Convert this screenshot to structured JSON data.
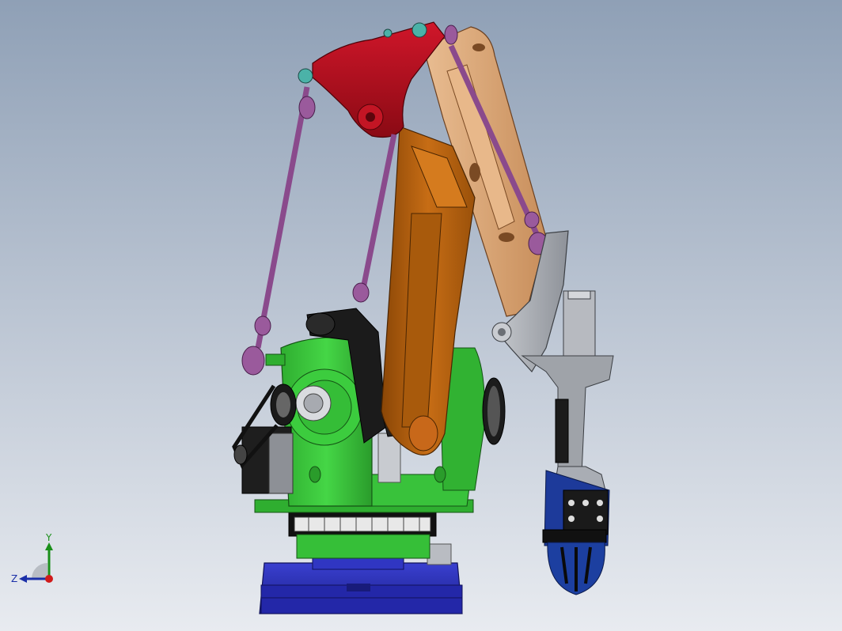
{
  "scene": {
    "description_free": true,
    "colors": {
      "background_top": "#8fa0b6",
      "background_bottom": "#e8ebf0",
      "base_blue": "#2a2fb5",
      "turntable_green": "#38c73a",
      "main_arm_orange": "#b8620f",
      "rear_arm_tan": "#d9a574",
      "top_link_red": "#b80f1d",
      "tie_rod_purple": "#8a4a8c",
      "wrist_gray": "#a9adb4",
      "gripper_blue": "#1c3fa0",
      "motor_black": "#1b1b1b"
    }
  },
  "triad": {
    "y_label": "Y",
    "z_label": "Z",
    "y_color": "#1a8f1a",
    "z_color": "#1a2fa8",
    "origin_color": "#d01a1a"
  }
}
